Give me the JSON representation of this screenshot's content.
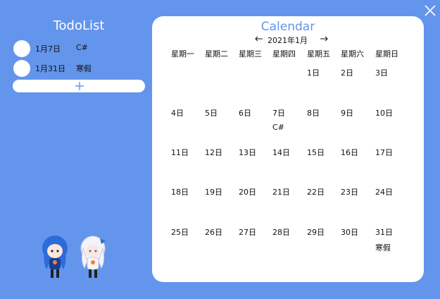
{
  "window": {
    "close_icon": "close-icon"
  },
  "todo": {
    "title": "TodoList",
    "items": [
      {
        "date": "1月7日",
        "text": "C#"
      },
      {
        "date": "1月31日",
        "text": "寒假"
      }
    ],
    "add_icon": "plus-icon"
  },
  "calendar": {
    "title": "Calendar",
    "month_label": "2021年1月",
    "prev_icon": "arrow-left-icon",
    "next_icon": "arrow-right-icon",
    "weekdays": [
      "星期一",
      "星期二",
      "星期三",
      "星期四",
      "星期五",
      "星期六",
      "星期日"
    ],
    "weeks": [
      [
        {
          "d": ""
        },
        {
          "d": ""
        },
        {
          "d": ""
        },
        {
          "d": ""
        },
        {
          "d": "1日"
        },
        {
          "d": "2日"
        },
        {
          "d": "3日"
        }
      ],
      [
        {
          "d": "4日"
        },
        {
          "d": "5日"
        },
        {
          "d": "6日"
        },
        {
          "d": "7日",
          "note": "C#"
        },
        {
          "d": "8日"
        },
        {
          "d": "9日"
        },
        {
          "d": "10日"
        }
      ],
      [
        {
          "d": "11日"
        },
        {
          "d": "12日"
        },
        {
          "d": "13日"
        },
        {
          "d": "14日"
        },
        {
          "d": "15日"
        },
        {
          "d": "16日"
        },
        {
          "d": "17日"
        }
      ],
      [
        {
          "d": "18日"
        },
        {
          "d": "19日"
        },
        {
          "d": "20日"
        },
        {
          "d": "21日"
        },
        {
          "d": "22日"
        },
        {
          "d": "23日"
        },
        {
          "d": "24日"
        }
      ],
      [
        {
          "d": "25日"
        },
        {
          "d": "26日"
        },
        {
          "d": "27日"
        },
        {
          "d": "28日"
        },
        {
          "d": "29日"
        },
        {
          "d": "30日"
        },
        {
          "d": "31日",
          "note": "寒假"
        }
      ]
    ]
  },
  "colors": {
    "background": "#6495ED",
    "accent": "#6495ED",
    "panel": "#ffffff"
  }
}
